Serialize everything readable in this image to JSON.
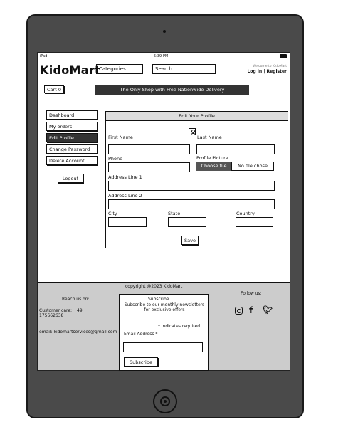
{
  "status": {
    "device": "iPad",
    "time": "5:39 PM"
  },
  "header": {
    "logo": "KidoMart",
    "categories_label": "Categories",
    "search_label": "Search",
    "welcome": "Welcome to KidoMart",
    "login_register": "Log in | Register",
    "cart_label": "Cart 0",
    "banner": "The Only Shop with Free Nationwide Delivery"
  },
  "sidebar": {
    "items": [
      {
        "label": "Dashboard"
      },
      {
        "label": "My orders"
      },
      {
        "label": "Edit Profile"
      },
      {
        "label": "Change Password"
      },
      {
        "label": "Delete Account"
      }
    ],
    "logout_label": "Logout"
  },
  "profile_form": {
    "title": "Edit Your Profile",
    "first_name_label": "First Name",
    "last_name_label": "Last Name",
    "phone_label": "Phone",
    "profile_picture_label": "Profile Picture",
    "choose_file_label": "Choose file",
    "no_file_label": "No file chose",
    "address1_label": "Address Line 1",
    "address2_label": "Address Line 2",
    "city_label": "City",
    "state_label": "State",
    "country_label": "Country",
    "save_label": "Save"
  },
  "footer": {
    "copyright": "copyright @2023 KidoMart",
    "reach_us": "Reach us on:",
    "customer_care": "Customer care: +49 175662638",
    "email": "email: kidomartservices@gmail.com",
    "subscribe_title": "Subscribe",
    "subscribe_text": "Subscribe to our monthly newsletters for exclusive offers",
    "required_note": "* indicates required",
    "email_label": "Email Address *",
    "subscribe_button": "Subscribe",
    "follow_us": "Follow us:",
    "social_icons": [
      "instagram-icon",
      "facebook-icon",
      "twitter-icon"
    ]
  },
  "colors": {
    "device_frame": "#4a4a4a",
    "banner_bg": "#333333",
    "footer_bg": "#cccccc",
    "active_menu": "#333333"
  }
}
